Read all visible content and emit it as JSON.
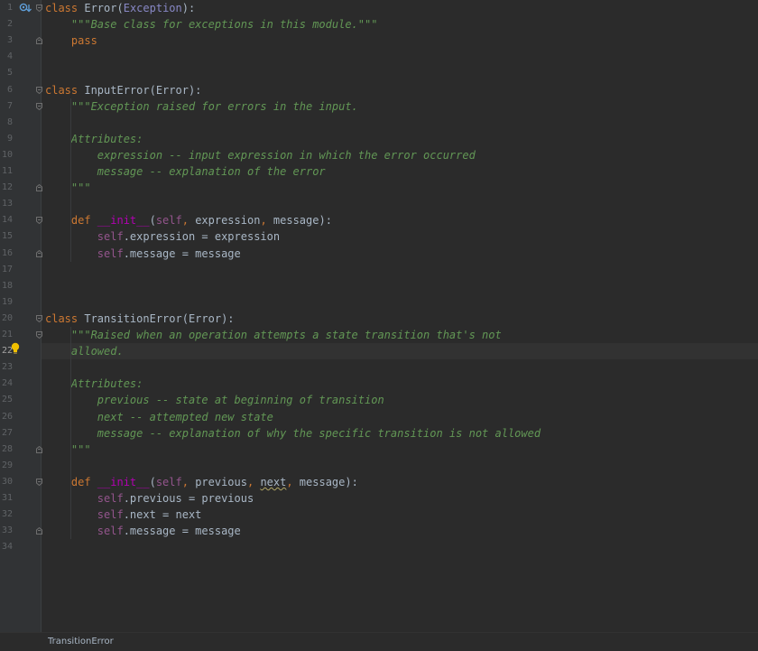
{
  "editor": {
    "current_line": 22,
    "breadcrumb": "TransitionError",
    "lines": [
      {
        "n": "1",
        "tokens": [
          [
            "kw",
            "class "
          ],
          [
            "cls",
            "Error"
          ],
          [
            "plain",
            "("
          ],
          [
            "base",
            "Exception"
          ],
          [
            "plain",
            "):"
          ]
        ]
      },
      {
        "n": "2",
        "tokens": [
          [
            "doc",
            "    \"\"\"Base class for exceptions in this module.\"\"\""
          ]
        ]
      },
      {
        "n": "3",
        "tokens": [
          [
            "kw",
            "    pass"
          ]
        ]
      },
      {
        "n": "4",
        "tokens": []
      },
      {
        "n": "5",
        "tokens": []
      },
      {
        "n": "6",
        "tokens": [
          [
            "kw",
            "class "
          ],
          [
            "cls",
            "InputError"
          ],
          [
            "plain",
            "(Error):"
          ]
        ]
      },
      {
        "n": "7",
        "tokens": [
          [
            "doc",
            "    \"\"\"Exception raised for errors in the input."
          ]
        ]
      },
      {
        "n": "8",
        "tokens": []
      },
      {
        "n": "9",
        "tokens": [
          [
            "doc",
            "    Attributes:"
          ]
        ]
      },
      {
        "n": "10",
        "tokens": [
          [
            "doc",
            "        expression -- input expression in which the error occurred"
          ]
        ]
      },
      {
        "n": "11",
        "tokens": [
          [
            "doc",
            "        message -- explanation of the error"
          ]
        ]
      },
      {
        "n": "12",
        "tokens": [
          [
            "doc",
            "    \"\"\""
          ]
        ]
      },
      {
        "n": "13",
        "tokens": []
      },
      {
        "n": "14",
        "tokens": [
          [
            "kw",
            "    def "
          ],
          [
            "dunder",
            "__init__"
          ],
          [
            "plain",
            "("
          ],
          [
            "self",
            "self"
          ],
          [
            "kw",
            ", "
          ],
          [
            "plain",
            "expression"
          ],
          [
            "kw",
            ", "
          ],
          [
            "plain",
            "message):"
          ]
        ]
      },
      {
        "n": "15",
        "tokens": [
          [
            "self",
            "        self"
          ],
          [
            "plain",
            ".expression = expression"
          ]
        ]
      },
      {
        "n": "16",
        "tokens": [
          [
            "self",
            "        self"
          ],
          [
            "plain",
            ".message = message"
          ]
        ]
      },
      {
        "n": "17",
        "tokens": []
      },
      {
        "n": "18",
        "tokens": []
      },
      {
        "n": "19",
        "tokens": []
      },
      {
        "n": "20",
        "tokens": [
          [
            "kw",
            "class "
          ],
          [
            "cls",
            "TransitionError"
          ],
          [
            "plain",
            "(Error):"
          ]
        ]
      },
      {
        "n": "21",
        "tokens": [
          [
            "doc",
            "    \"\"\"Raised when an operation attempts a state transition that's not"
          ]
        ]
      },
      {
        "n": "22",
        "tokens": [
          [
            "doc",
            "    allowed."
          ]
        ]
      },
      {
        "n": "23",
        "tokens": []
      },
      {
        "n": "24",
        "tokens": [
          [
            "doc",
            "    Attributes:"
          ]
        ]
      },
      {
        "n": "25",
        "tokens": [
          [
            "doc",
            "        previous -- state at beginning of transition"
          ]
        ]
      },
      {
        "n": "26",
        "tokens": [
          [
            "doc",
            "        next -- attempted new state"
          ]
        ]
      },
      {
        "n": "27",
        "tokens": [
          [
            "doc",
            "        message -- explanation of why the specific transition is not allowed"
          ]
        ]
      },
      {
        "n": "28",
        "tokens": [
          [
            "doc",
            "    \"\"\""
          ]
        ]
      },
      {
        "n": "29",
        "tokens": []
      },
      {
        "n": "30",
        "tokens": [
          [
            "kw",
            "    def "
          ],
          [
            "dunder",
            "__init__"
          ],
          [
            "plain",
            "("
          ],
          [
            "self",
            "self"
          ],
          [
            "kw",
            ", "
          ],
          [
            "plain",
            "previous"
          ],
          [
            "kw",
            ", "
          ],
          [
            "squig",
            "next"
          ],
          [
            "kw",
            ", "
          ],
          [
            "plain",
            "message):"
          ]
        ]
      },
      {
        "n": "31",
        "tokens": [
          [
            "self",
            "        self"
          ],
          [
            "plain",
            ".previous = previous"
          ]
        ]
      },
      {
        "n": "32",
        "tokens": [
          [
            "self",
            "        self"
          ],
          [
            "plain",
            ".next = next"
          ]
        ]
      },
      {
        "n": "33",
        "tokens": [
          [
            "self",
            "        self"
          ],
          [
            "plain",
            ".message = message"
          ]
        ]
      },
      {
        "n": "34",
        "tokens": []
      }
    ],
    "fold_markers": {
      "1": "open",
      "3": "close",
      "6": "open",
      "7": "open",
      "12": "close",
      "14": "open",
      "16": "close",
      "20": "open",
      "21": "open",
      "28": "close",
      "30": "open",
      "33": "close"
    },
    "icons": {
      "override": "override-method-icon",
      "bulb": "intention-bulb-icon"
    },
    "colors": {
      "background": "#2b2b2b",
      "keyword": "#cc7832",
      "docstring": "#629755",
      "self": "#94558d",
      "dunder": "#b200b2",
      "builtin": "#8888c6"
    }
  }
}
